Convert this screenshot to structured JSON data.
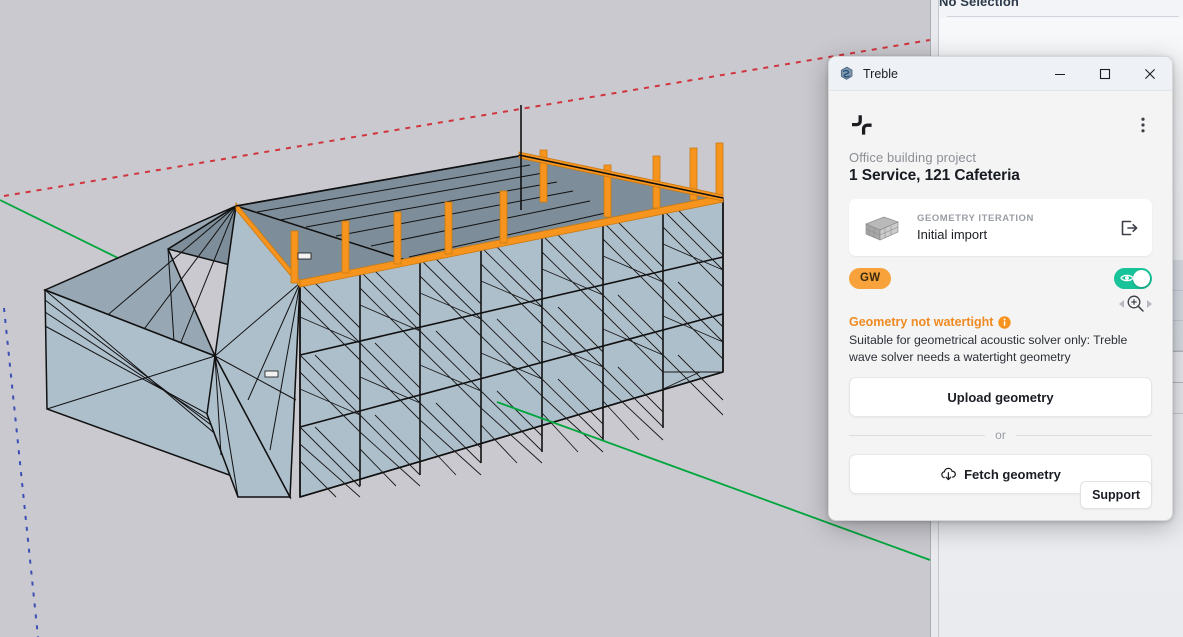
{
  "app": {
    "title": "Treble",
    "icon": "sketchup-extension-icon",
    "brand_logo": "treble-logo"
  },
  "window_controls": {
    "minimize": "minimize-icon",
    "maximize": "maximize-icon",
    "close": "close-icon"
  },
  "panel": {
    "menu_icon": "kebab-menu-icon",
    "project_name": "Office building project",
    "model_name": "1 Service, 121 Cafeteria",
    "geometry_card": {
      "label": "GEOMETRY ITERATION",
      "value": "Initial import",
      "thumbnail": "building-thumbnail",
      "export_icon": "export-icon"
    },
    "status": {
      "badge": "GW",
      "badge_color": "#f7a23b",
      "warning_title": "Geometry not watertight",
      "warning_info_icon": "info-icon",
      "warning_description": "Suitable for geometrical acoustic solver only: Treble wave solver needs a watertight geometry",
      "warning_color": "#ef8b22",
      "visibility_toggle": {
        "icon": "eye-icon",
        "state": "on",
        "on_color": "#18c39a"
      },
      "zoom_control": {
        "prev_icon": "arrow-left-icon",
        "zoom_icon": "zoom-in-icon",
        "next_icon": "arrow-right-icon"
      }
    },
    "upload_button": "Upload geometry",
    "or_label": "or",
    "fetch_button": "Fetch geometry",
    "fetch_icon": "cloud-download-icon",
    "support_button": "Support"
  },
  "tray": {
    "header": "No Selection"
  },
  "viewport": {
    "background_color": "#c9c9cf",
    "model_face_color": "#aebfcc",
    "model_roof_color": "#7d8d99",
    "model_edge_color": "#111111",
    "highlight_color": "#f7941e",
    "axis_red": "#d1343c",
    "axis_green": "#00a63c",
    "axis_blue": "#3b4fb5"
  }
}
